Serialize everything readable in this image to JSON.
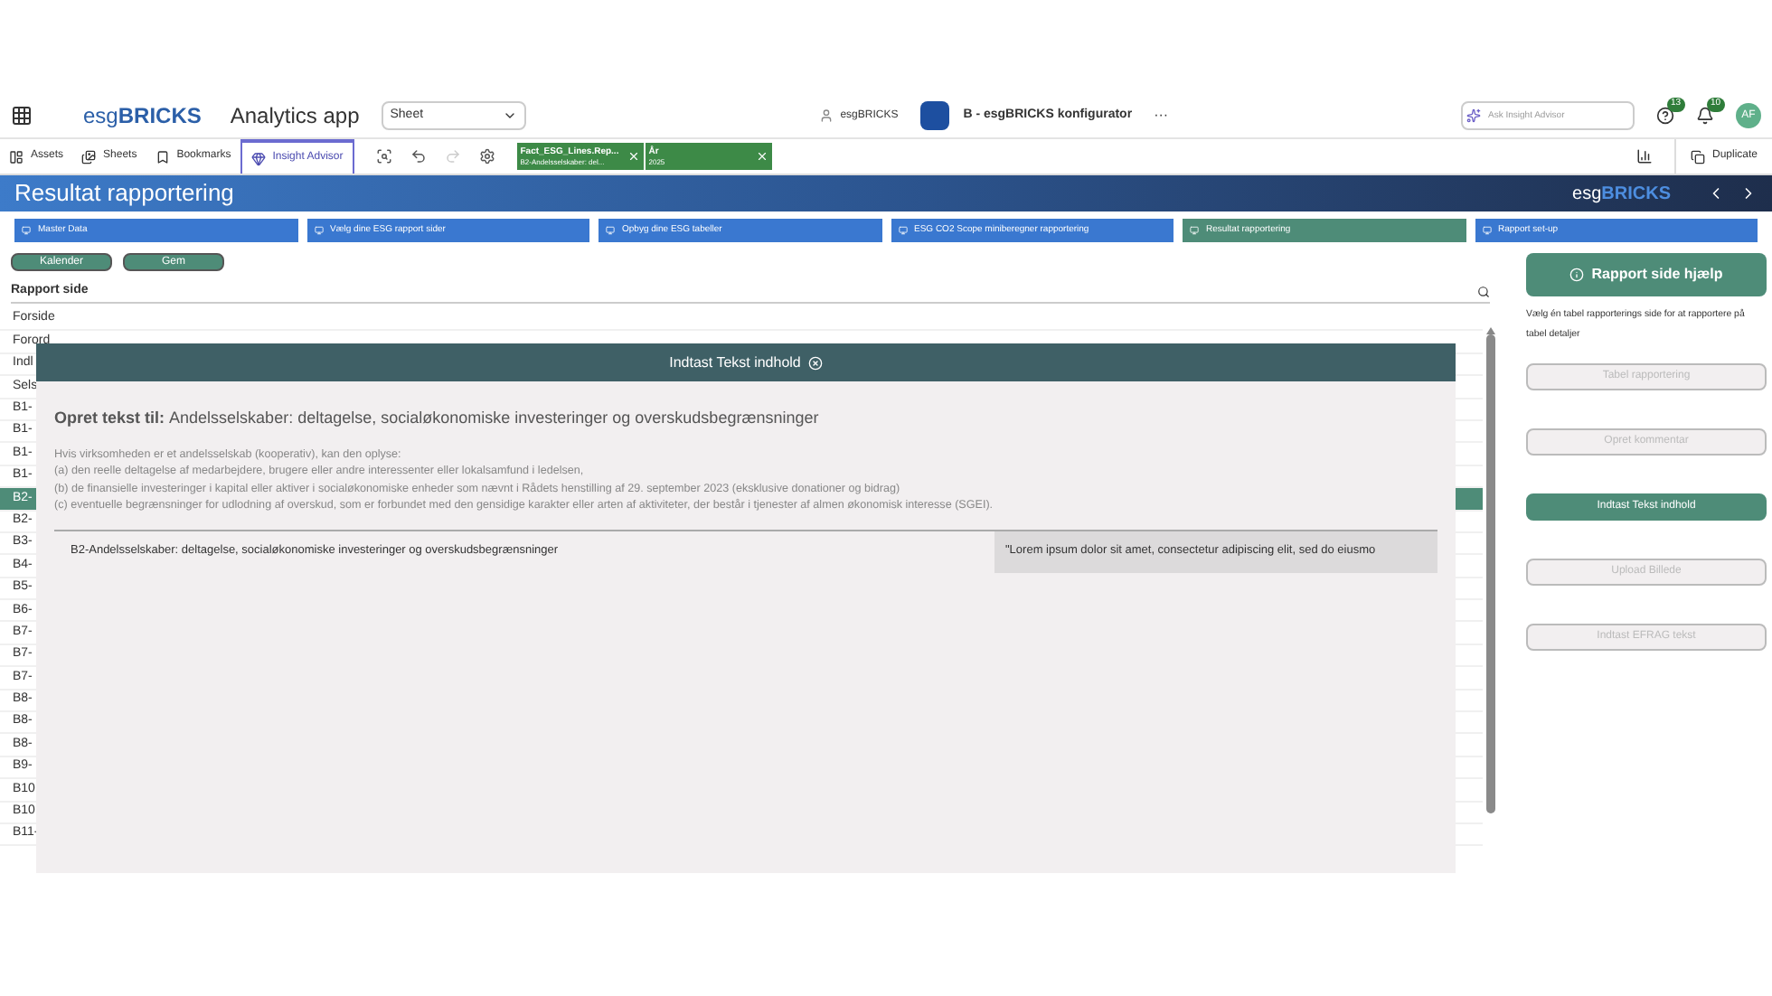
{
  "topbar": {
    "logo_plain": "esg",
    "logo_bold": "BRICKS",
    "app_name": "Analytics app",
    "sheet_select": "Sheet",
    "space": "esgBRICKS",
    "app_title": "B - esgBRICKS konfigurator",
    "more": "···",
    "search_placeholder": "Ask Insight Advisor",
    "help_badge": "13",
    "notif_badge": "10",
    "avatar": "AF"
  },
  "toolbar": {
    "items": [
      {
        "label": "Assets",
        "selected": false
      },
      {
        "label": "Sheets",
        "selected": false
      },
      {
        "label": "Bookmarks",
        "selected": false
      },
      {
        "label": "Insight Advisor",
        "selected": true
      }
    ],
    "filters": [
      {
        "field": "Fact_ESG_Lines.Rep...",
        "value": "B2-Andelsselskaber: del..."
      },
      {
        "field": "År",
        "value": "2025"
      }
    ],
    "duplicate": "Duplicate"
  },
  "banner": {
    "title": "Resultat rapportering",
    "logo_plain": "esg",
    "logo_bold": "BRICKS"
  },
  "nav": [
    {
      "label": "Master Data",
      "selected": false
    },
    {
      "label": "Vælg dine ESG rapport sider",
      "selected": false
    },
    {
      "label": "Opbyg dine ESG tabeller",
      "selected": false
    },
    {
      "label": "ESG CO2 Scope miniberegner rapportering",
      "selected": false
    },
    {
      "label": "Resultat rapportering",
      "selected": true
    },
    {
      "label": "Rapport set-up",
      "selected": false
    }
  ],
  "actions": [
    "Kalender",
    "Gem"
  ],
  "list": {
    "header": "Rapport side",
    "rows": [
      {
        "text": "Forside",
        "selected": false
      },
      {
        "text": "Forord",
        "selected": false
      },
      {
        "text": "Indl",
        "selected": false
      },
      {
        "text": "Sels",
        "selected": false
      },
      {
        "text": "B1-",
        "selected": false
      },
      {
        "text": "B1-",
        "selected": false
      },
      {
        "text": "B1-",
        "selected": false
      },
      {
        "text": "B1-",
        "selected": false
      },
      {
        "text": "B2-",
        "selected": true
      },
      {
        "text": "B2-",
        "selected": false
      },
      {
        "text": "B3-",
        "selected": false
      },
      {
        "text": "B4-",
        "selected": false
      },
      {
        "text": "B5-",
        "selected": false
      },
      {
        "text": "B6-",
        "selected": false
      },
      {
        "text": "B7-",
        "selected": false
      },
      {
        "text": "B7-",
        "selected": false
      },
      {
        "text": "B7-",
        "selected": false
      },
      {
        "text": "B8-",
        "selected": false
      },
      {
        "text": "B8-",
        "selected": false
      },
      {
        "text": "B8-",
        "selected": false
      },
      {
        "text": "B9-",
        "selected": false
      },
      {
        "text": "B10",
        "selected": false
      },
      {
        "text": "B10",
        "selected": false
      },
      {
        "text": "B11-",
        "selected": false
      }
    ]
  },
  "modal": {
    "title": "Indtast Tekst indhold",
    "heading_label": "Opret tekst til:",
    "heading": "Andelsselskaber: deltagelse, socialøkonomiske investeringer og overskudsbegrænsninger",
    "description": [
      "Hvis virksomheden er et andelsselskab (kooperativ), kan den oplyse:",
      "(a) den reelle deltagelse af medarbejdere, brugere eller andre interessenter eller lokalsamfund i ledelsen,",
      "(b) de finansielle investeringer i kapital eller aktiver i socialøkonomiske enheder som nævnt i Rådets henstilling af 29. september 2023 (eksklusive donationer og bidrag)",
      "(c) eventuelle begrænsninger for udlodning af overskud, som er forbundet med den gensidige karakter eller arten af aktiviteter, der består i tjenester af almen økonomisk interesse (SGEI)."
    ],
    "row_label": "B2-Andelsselskaber: deltagelse, socialøkonomiske investeringer og overskudsbegrænsninger",
    "row_value": "\"Lorem ipsum dolor sit amet, consectetur adipiscing elit, sed do eiusmo"
  },
  "side": {
    "help": "Rapport side hjælp",
    "hint": "Vælg én tabel rapporterings side for at rapportere på tabel detaljer",
    "buttons": [
      {
        "label": "Tabel rapportering",
        "disabled": true
      },
      {
        "label": "Opret kommentar",
        "disabled": true
      },
      {
        "label": "Indtast Tekst indhold",
        "disabled": false
      },
      {
        "label": "Upload Billede",
        "disabled": true
      },
      {
        "label": "Indtast EFRAG tekst",
        "disabled": true
      }
    ]
  }
}
